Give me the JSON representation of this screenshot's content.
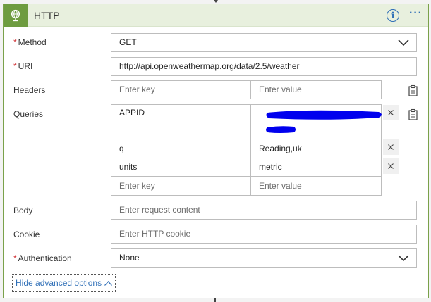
{
  "header": {
    "title": "HTTP",
    "info_label": "i",
    "more_label": "···"
  },
  "fields": {
    "method": {
      "label": "Method",
      "required": "*",
      "value": "GET"
    },
    "uri": {
      "label": "URI",
      "required": "*",
      "value": "http://api.openweathermap.org/data/2.5/weather"
    },
    "headers": {
      "label": "Headers",
      "key_placeholder": "Enter key",
      "value_placeholder": "Enter value"
    },
    "queries": {
      "label": "Queries",
      "rows": [
        {
          "key": "APPID",
          "value": ""
        },
        {
          "key": "q",
          "value": "Reading,uk"
        },
        {
          "key": "units",
          "value": "metric"
        }
      ],
      "key_placeholder": "Enter key",
      "value_placeholder": "Enter value"
    },
    "body": {
      "label": "Body",
      "placeholder": "Enter request content"
    },
    "cookie": {
      "label": "Cookie",
      "placeholder": "Enter HTTP cookie"
    },
    "authentication": {
      "label": "Authentication",
      "required": "*",
      "value": "None"
    }
  },
  "advanced": {
    "label": "Hide advanced options"
  },
  "colors": {
    "accent": "#6e9c40",
    "link": "#2f6fb7",
    "required": "#d13438",
    "redaction": "#0000ee"
  },
  "icons": {
    "header": "globe-icon",
    "delete": "close-icon",
    "switch": "clipboard-icon",
    "dropdown": "chevron-down-icon",
    "collapse": "chevron-up-icon"
  }
}
